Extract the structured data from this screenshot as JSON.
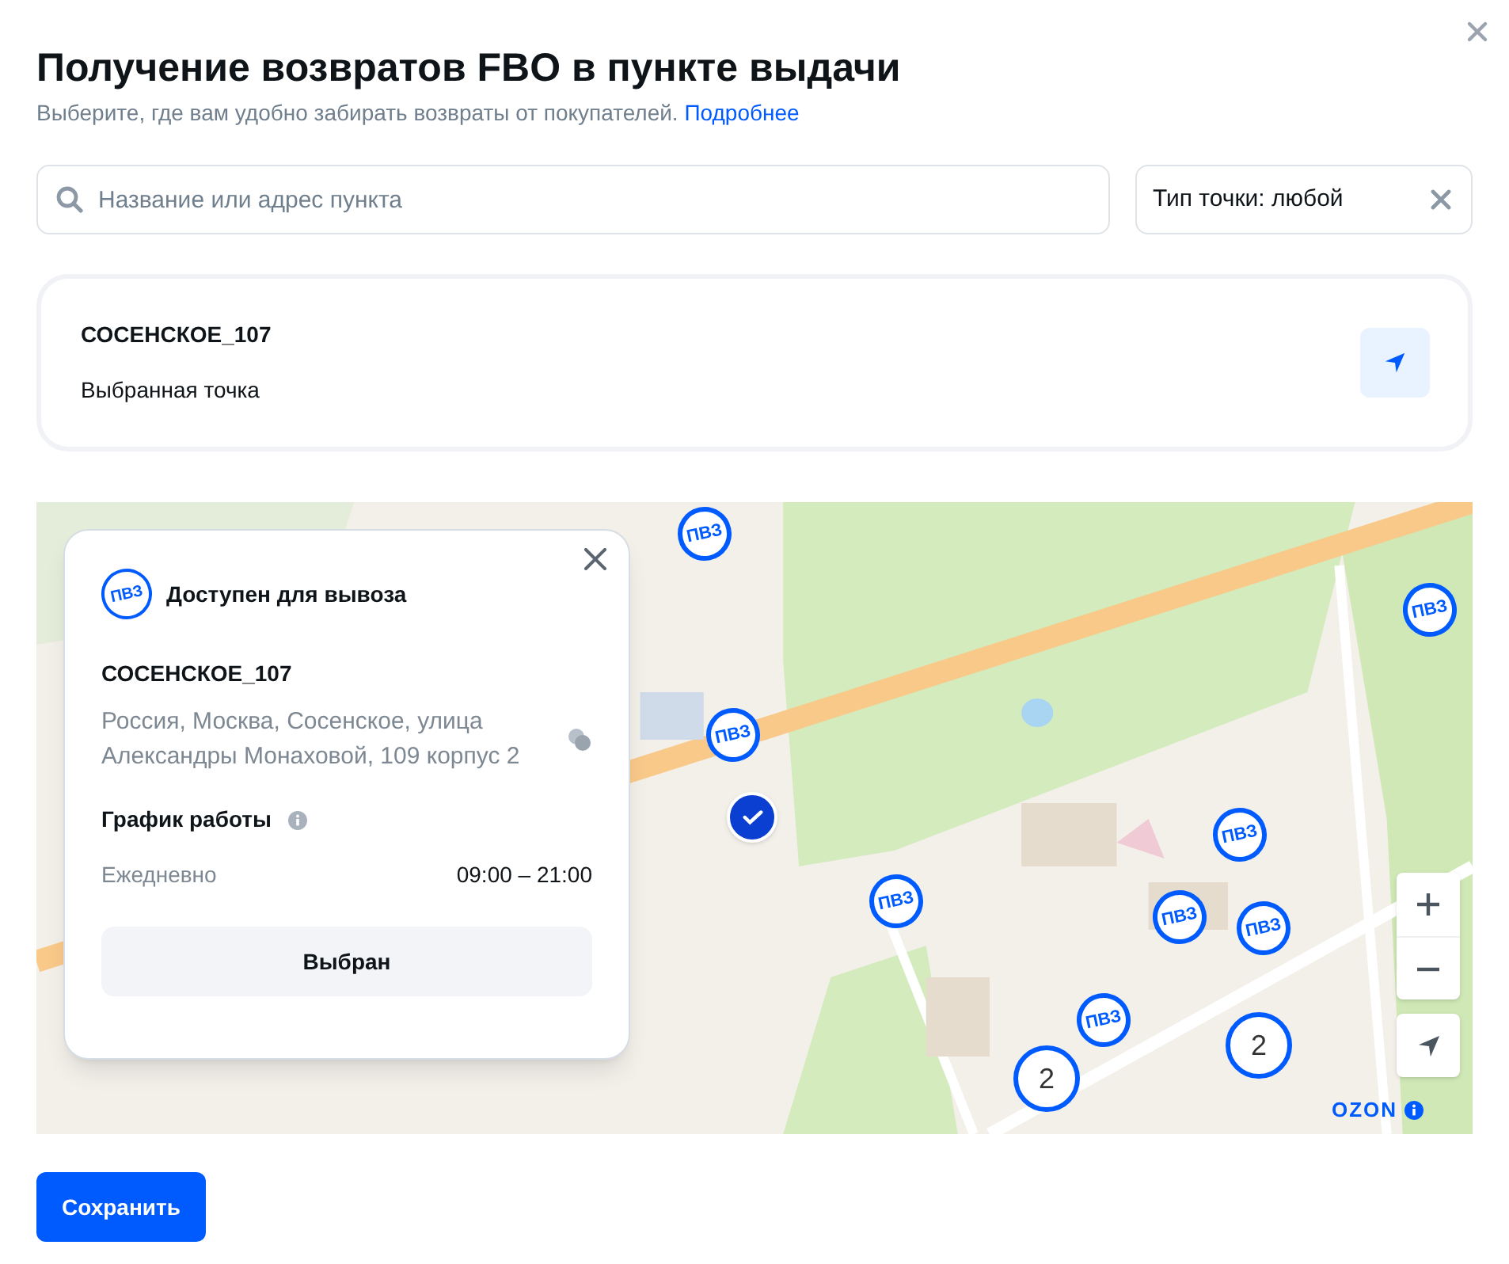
{
  "title": "Получение возвратов FBO в пункте выдачи",
  "subtitle": {
    "text": "Выберите, где вам удобно забирать возвраты от покупателей.",
    "link": "Подробнее"
  },
  "search": {
    "placeholder": "Название или адрес пункта"
  },
  "filter": {
    "label": "Тип точки: любой"
  },
  "selected_point": {
    "name": "СОСЕНСКОЕ_107",
    "caption": "Выбранная точка"
  },
  "map": {
    "markers": [
      {
        "kind": "pvz",
        "label": "ПВЗ"
      },
      {
        "kind": "pvz",
        "label": "ПВЗ"
      },
      {
        "kind": "pvz",
        "label": "ПВЗ"
      },
      {
        "kind": "pvz",
        "label": "ПВЗ"
      },
      {
        "kind": "pvz",
        "label": "ПВЗ"
      },
      {
        "kind": "pvz",
        "label": "ПВЗ"
      },
      {
        "kind": "pvz",
        "label": "ПВЗ"
      },
      {
        "kind": "pvz",
        "label": "ПВЗ"
      },
      {
        "kind": "selected"
      },
      {
        "kind": "cluster",
        "label": "2"
      },
      {
        "kind": "cluster",
        "label": "2"
      }
    ],
    "popup": {
      "badge": "ПВЗ",
      "status": "Доступен для вывоза",
      "name": "СОСЕНСКОЕ_107",
      "address": "Россия, Москва, Сосенское, улица Александры Монаховой, 109 корпус 2",
      "schedule_title": "График работы",
      "schedule": [
        {
          "day": "Ежедневно",
          "hours": "09:00 – 21:00"
        }
      ],
      "button": "Выбран"
    },
    "logo": "OZON"
  },
  "save_button": "Сохранить"
}
